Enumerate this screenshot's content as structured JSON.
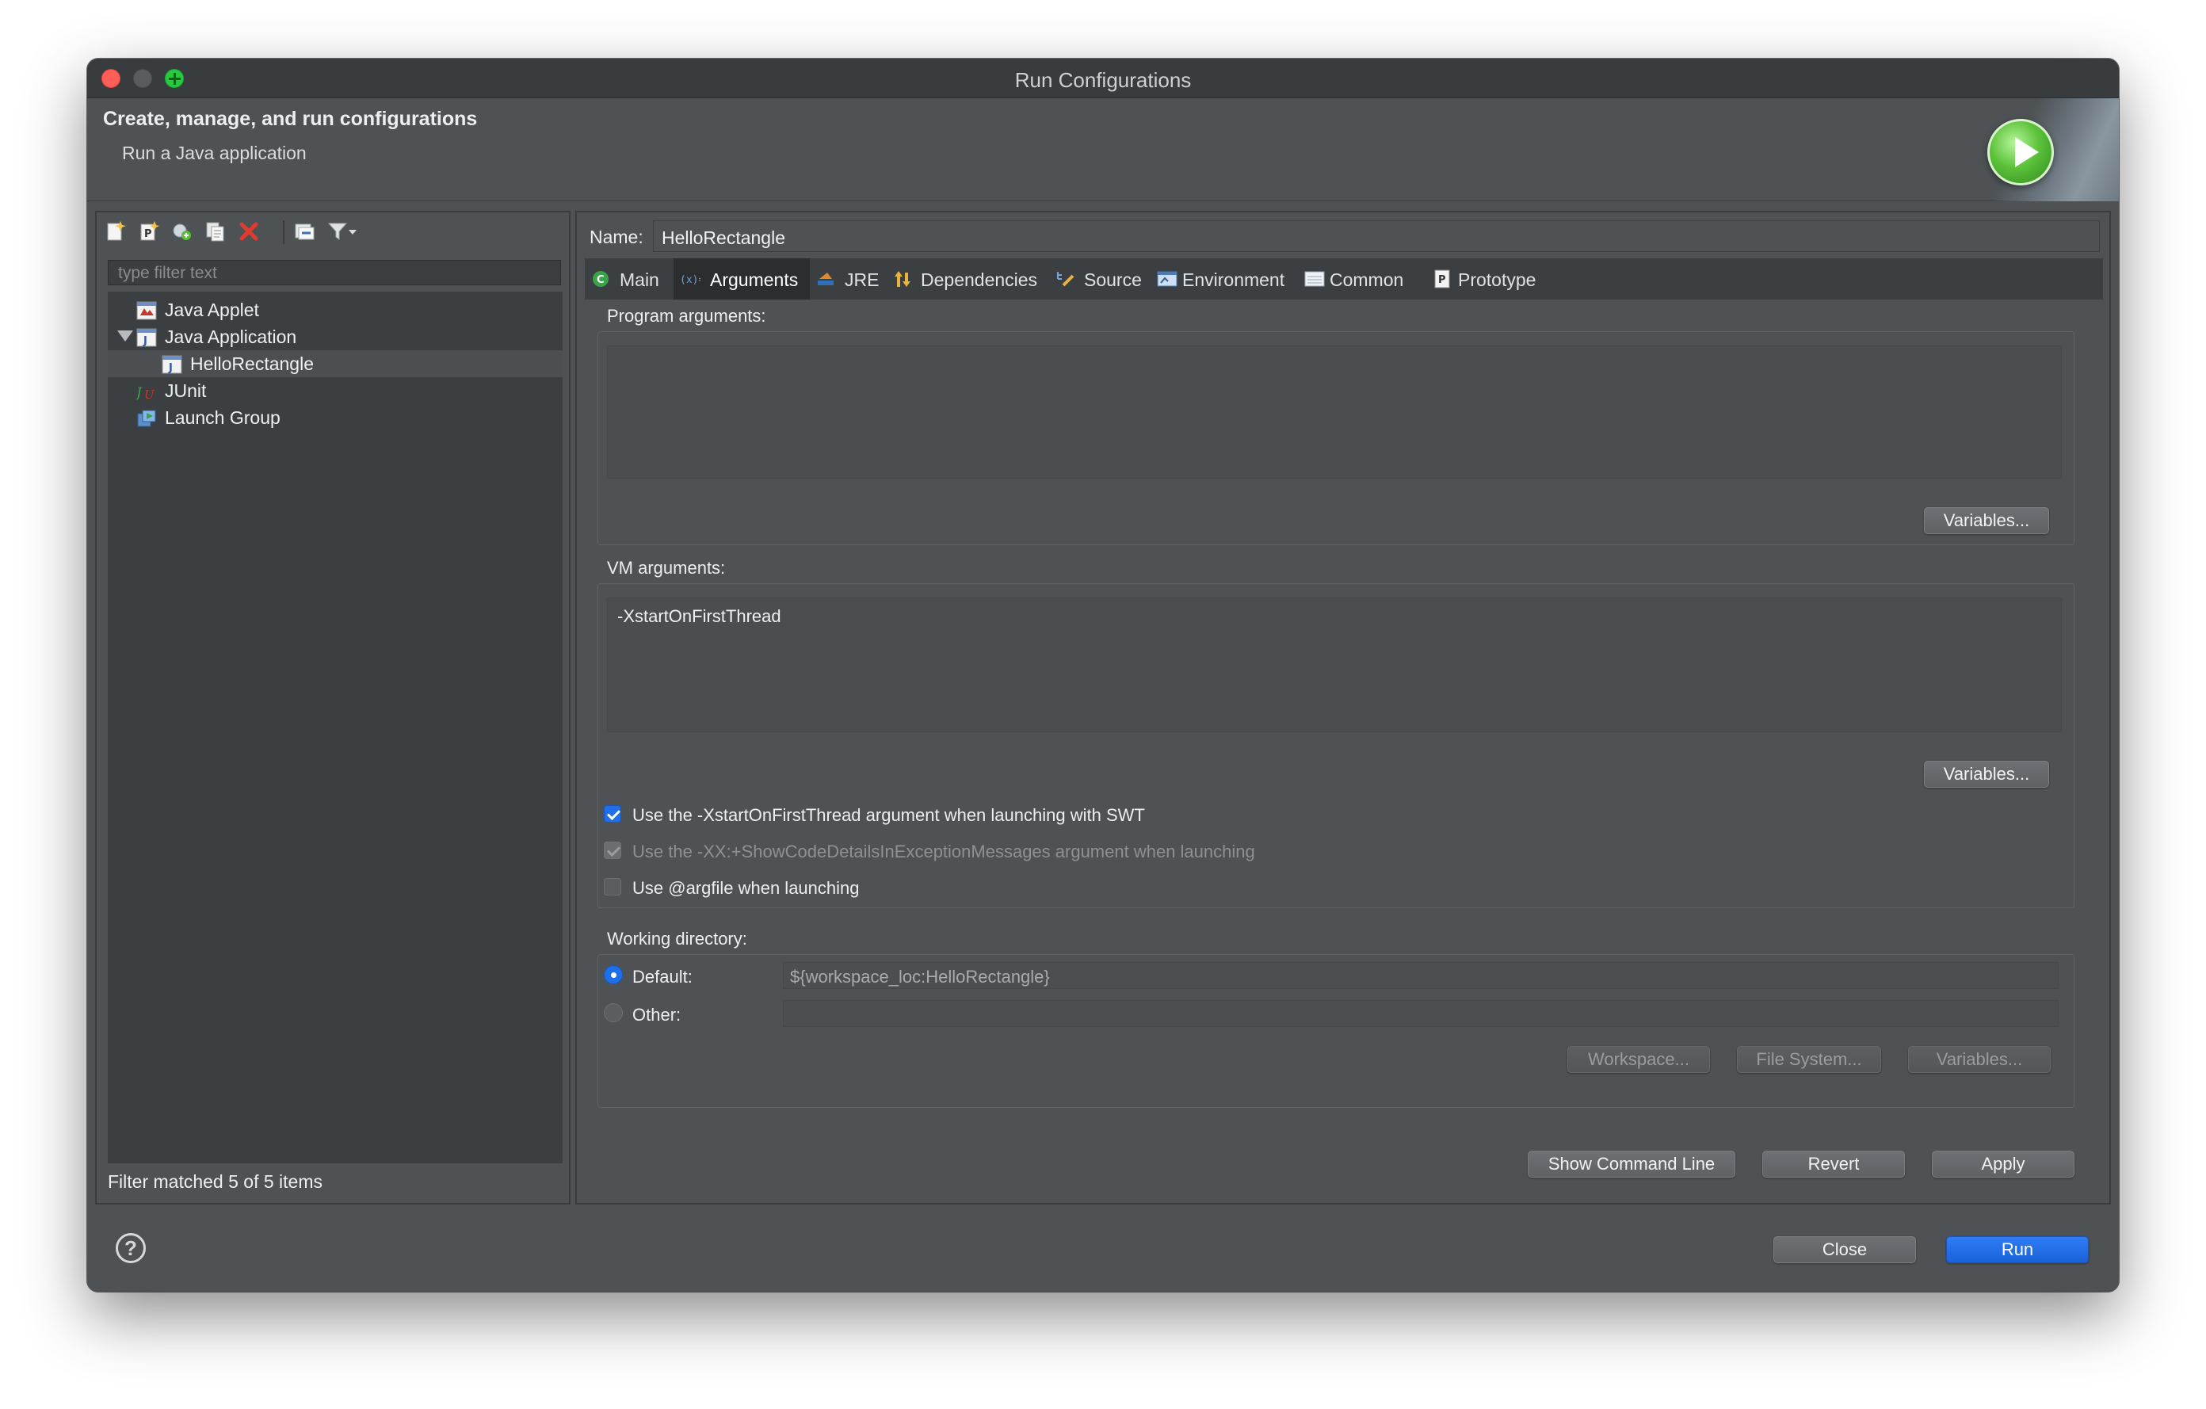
{
  "window": {
    "title": "Run Configurations"
  },
  "header": {
    "title": "Create, manage, and run configurations",
    "subtitle": "Run a Java application"
  },
  "left": {
    "toolbar": [
      "new-config-icon",
      "new-prototype-icon",
      "export-icon",
      "duplicate-icon",
      "delete-icon",
      "collapse-all-icon",
      "filter-icon"
    ],
    "filter_placeholder": "type filter text",
    "tree": [
      {
        "label": "Java Applet",
        "icon": "java-applet-icon",
        "level": 0
      },
      {
        "label": "Java Application",
        "icon": "java-application-icon",
        "level": 0,
        "expanded": true
      },
      {
        "label": "HelloRectangle",
        "icon": "java-class-icon",
        "level": 1,
        "selected": true
      },
      {
        "label": "JUnit",
        "icon": "junit-icon",
        "level": 0
      },
      {
        "label": "Launch Group",
        "icon": "launch-group-icon",
        "level": 0
      }
    ],
    "filter_status": "Filter matched 5 of 5 items"
  },
  "right": {
    "name_label": "Name:",
    "name_value": "HelloRectangle",
    "tabs": [
      {
        "label": "Main",
        "icon": "main-icon"
      },
      {
        "label": "Arguments",
        "icon": "arguments-icon",
        "active": true
      },
      {
        "label": "JRE",
        "icon": "jre-icon"
      },
      {
        "label": "Dependencies",
        "icon": "dependencies-icon"
      },
      {
        "label": "Source",
        "icon": "source-icon"
      },
      {
        "label": "Environment",
        "icon": "environment-icon"
      },
      {
        "label": "Common",
        "icon": "common-icon"
      },
      {
        "label": "Prototype",
        "icon": "prototype-icon"
      }
    ],
    "program_args": {
      "label": "Program arguments:",
      "value": "",
      "variables_button": "Variables..."
    },
    "vm_args": {
      "label": "VM arguments:",
      "value": "-XstartOnFirstThread",
      "variables_button": "Variables..."
    },
    "options": [
      {
        "label": "Use the -XstartOnFirstThread argument when launching with SWT",
        "checked": true,
        "enabled": true
      },
      {
        "label": "Use the -XX:+ShowCodeDetailsInExceptionMessages argument when launching",
        "checked": true,
        "enabled": false
      },
      {
        "label": "Use @argfile when launching",
        "checked": false,
        "enabled": true
      }
    ],
    "working_dir": {
      "label": "Working directory:",
      "default_label": "Default:",
      "default_value": "${workspace_loc:HelloRectangle}",
      "other_label": "Other:",
      "other_value": "",
      "buttons": [
        "Workspace...",
        "File System...",
        "Variables..."
      ]
    },
    "actions": {
      "show_command_line": "Show Command Line",
      "revert": "Revert",
      "apply": "Apply"
    }
  },
  "footer": {
    "close": "Close",
    "run": "Run"
  },
  "colors": {
    "accent": "#1f6fe8",
    "window_bg": "#4e5254",
    "tree_bg": "#3c3f41"
  }
}
